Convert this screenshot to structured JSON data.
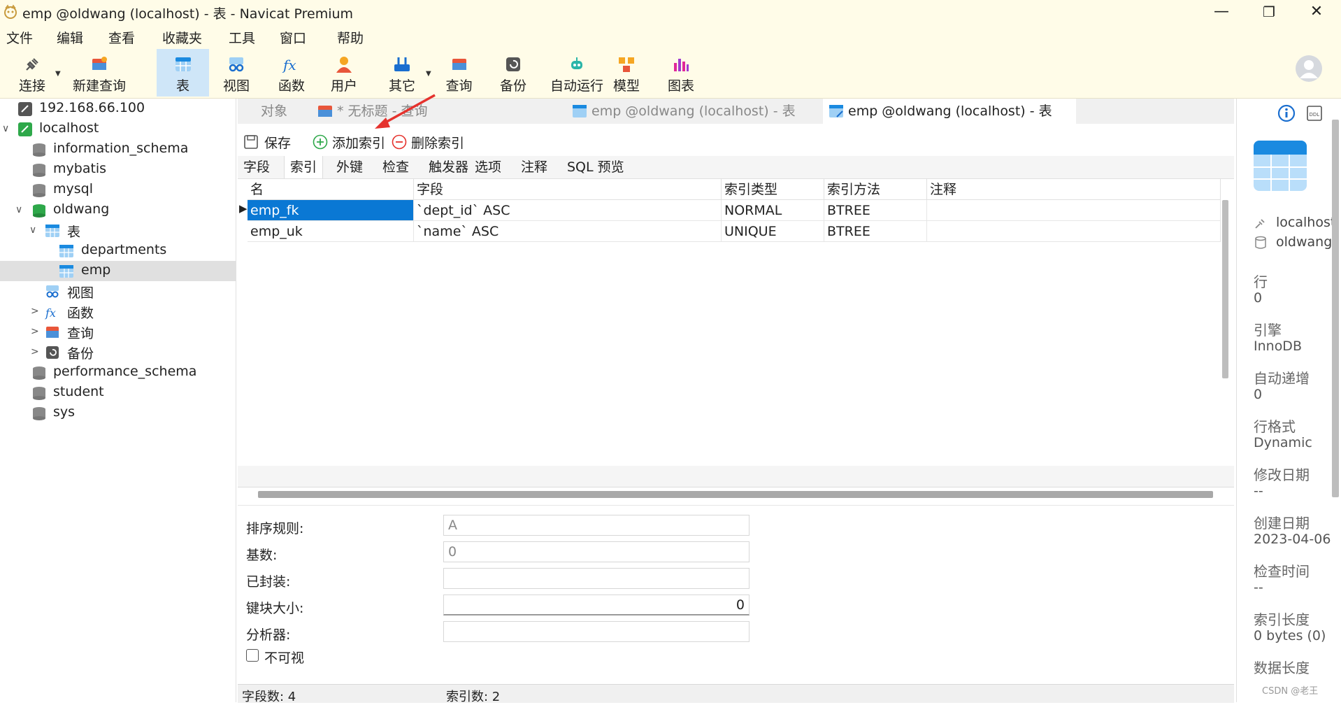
{
  "window": {
    "title": "emp @oldwang (localhost) - 表 - Navicat Premium",
    "minimize": "—",
    "maximize": "❐",
    "close": "✕"
  },
  "menu": [
    "文件",
    "编辑",
    "查看",
    "收藏夹",
    "工具",
    "窗口",
    "帮助"
  ],
  "toolbar": {
    "buttons": [
      {
        "label": "连接",
        "icon": "plug-icon"
      },
      {
        "label": "新建查询",
        "icon": "new-query-icon"
      },
      {
        "label": "表",
        "icon": "table-icon",
        "active": true
      },
      {
        "label": "视图",
        "icon": "view-icon"
      },
      {
        "label": "函数",
        "icon": "function-icon"
      },
      {
        "label": "用户",
        "icon": "user-icon"
      },
      {
        "label": "其它",
        "icon": "tools-icon"
      },
      {
        "label": "查询",
        "icon": "query-icon"
      },
      {
        "label": "备份",
        "icon": "backup-icon"
      },
      {
        "label": "自动运行",
        "icon": "robot-icon"
      },
      {
        "label": "模型",
        "icon": "model-icon"
      },
      {
        "label": "图表",
        "icon": "chart-icon"
      }
    ]
  },
  "tree": {
    "items": [
      {
        "label": "192.168.66.100",
        "icon": "connection-icon"
      },
      {
        "label": "localhost",
        "icon": "connection-active-icon",
        "arrow": "∨"
      },
      {
        "label": "information_schema",
        "icon": "database-icon"
      },
      {
        "label": "mybatis",
        "icon": "database-icon"
      },
      {
        "label": "mysql",
        "icon": "database-icon"
      },
      {
        "label": "oldwang",
        "icon": "database-open-icon",
        "arrow": "∨"
      },
      {
        "label": "表",
        "icon": "table-icon",
        "arrow": "∨"
      },
      {
        "label": "departments",
        "icon": "table-icon"
      },
      {
        "label": "emp",
        "icon": "table-icon",
        "selected": true
      },
      {
        "label": "视图",
        "icon": "view-icon"
      },
      {
        "label": "函数",
        "icon": "function-icon",
        "arrow": ">"
      },
      {
        "label": "查询",
        "icon": "query-icon",
        "arrow": ">"
      },
      {
        "label": "备份",
        "icon": "backup-icon",
        "arrow": ">"
      },
      {
        "label": "performance_schema",
        "icon": "database-icon"
      },
      {
        "label": "student",
        "icon": "database-icon"
      },
      {
        "label": "sys",
        "icon": "database-icon"
      }
    ]
  },
  "tabs": [
    {
      "label": "对象"
    },
    {
      "label": "* 无标题 - 查询"
    },
    {
      "label": "emp @oldwang (localhost) - 表"
    },
    {
      "label": "emp @oldwang (localhost) - 表",
      "active": true
    }
  ],
  "actions": {
    "save": "保存",
    "add_index": "添加索引",
    "delete_index": "删除索引"
  },
  "subtabs": [
    "字段",
    "索引",
    "外键",
    "检查",
    "触发器",
    "选项",
    "注释",
    "SQL 预览"
  ],
  "grid": {
    "columns": [
      "名",
      "字段",
      "索引类型",
      "索引方法",
      "注释"
    ],
    "rows": [
      {
        "name": "emp_fk",
        "field": "`dept_id` ASC",
        "type": "NORMAL",
        "method": "BTREE",
        "comment": ""
      },
      {
        "name": "emp_uk",
        "field": "`name` ASC",
        "type": "UNIQUE",
        "method": "BTREE",
        "comment": ""
      }
    ]
  },
  "props": {
    "collation_label": "排序规则:",
    "collation_value": "A",
    "cardinality_label": "基数:",
    "cardinality_value": "0",
    "packed_label": "已封装:",
    "packed_value": "",
    "key_block_label": "键块大小:",
    "key_block_value": "0",
    "parser_label": "分析器:",
    "parser_value": "",
    "invisible_label": "不可视"
  },
  "status": {
    "field_count": "字段数: 4",
    "index_count": "索引数: 2"
  },
  "right_panel": {
    "host": "localhost",
    "db": "oldwang",
    "items": [
      {
        "label": "行",
        "value": "0"
      },
      {
        "label": "引擎",
        "value": "InnoDB"
      },
      {
        "label": "自动递增",
        "value": "0"
      },
      {
        "label": "行格式",
        "value": "Dynamic"
      },
      {
        "label": "修改日期",
        "value": "--"
      },
      {
        "label": "创建日期",
        "value": "2023-04-06"
      },
      {
        "label": "检查时间",
        "value": "--"
      },
      {
        "label": "索引长度",
        "value": "0 bytes (0)"
      },
      {
        "label": "数据长度",
        "value": ""
      }
    ],
    "watermark": "CSDN @老王"
  },
  "colors": {
    "titlebar_bg": "#fffce8",
    "selection": "#0a78d4",
    "active_toolbar": "#cfe6f8",
    "arrow_red": "#e5322d"
  }
}
